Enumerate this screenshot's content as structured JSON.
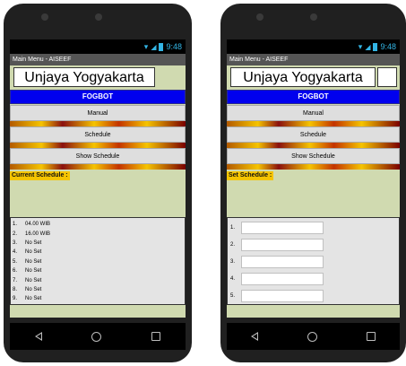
{
  "left": {
    "status_time": "9:48",
    "title": "Main Menu - AISEEF",
    "logo_text": "Unjaya Yogyakarta",
    "fogbot": "FOGBOT",
    "buttons": [
      "Manual",
      "Schedule",
      "Show Schedule"
    ],
    "section_label": "Current Schedule :",
    "schedule": [
      {
        "num": "1.",
        "value": "04.00 WIB"
      },
      {
        "num": "2.",
        "value": "16.00 WIB"
      },
      {
        "num": "3.",
        "value": "No Set"
      },
      {
        "num": "4.",
        "value": "No Set"
      },
      {
        "num": "5.",
        "value": "No Set"
      },
      {
        "num": "6.",
        "value": "No Set"
      },
      {
        "num": "7.",
        "value": "No Set"
      },
      {
        "num": "8.",
        "value": "No Set"
      },
      {
        "num": "9.",
        "value": "No Set"
      }
    ]
  },
  "right": {
    "status_time": "9:48",
    "title": "Main Menu - AISEEF",
    "logo_text": "Unjaya Yogyakarta",
    "fogbot": "FOGBOT",
    "buttons": [
      "Manual",
      "Schedule",
      "Show Schedule"
    ],
    "section_label": "Set Schedule :",
    "fields": [
      {
        "num": "1.",
        "value": ""
      },
      {
        "num": "2.",
        "value": ""
      },
      {
        "num": "3.",
        "value": ""
      },
      {
        "num": "4.",
        "value": ""
      },
      {
        "num": "5.",
        "value": ""
      }
    ]
  },
  "icons": {
    "wifi": "wifi-icon",
    "signal": "signal-icon",
    "battery": "battery-icon",
    "back": "back-icon",
    "home": "home-icon",
    "recent": "recent-apps-icon"
  },
  "colors": {
    "fogbot_bar": "#0000ee",
    "section_label": "#f5c400",
    "status_icons": "#33b5e5",
    "background": "#d0dab0"
  }
}
